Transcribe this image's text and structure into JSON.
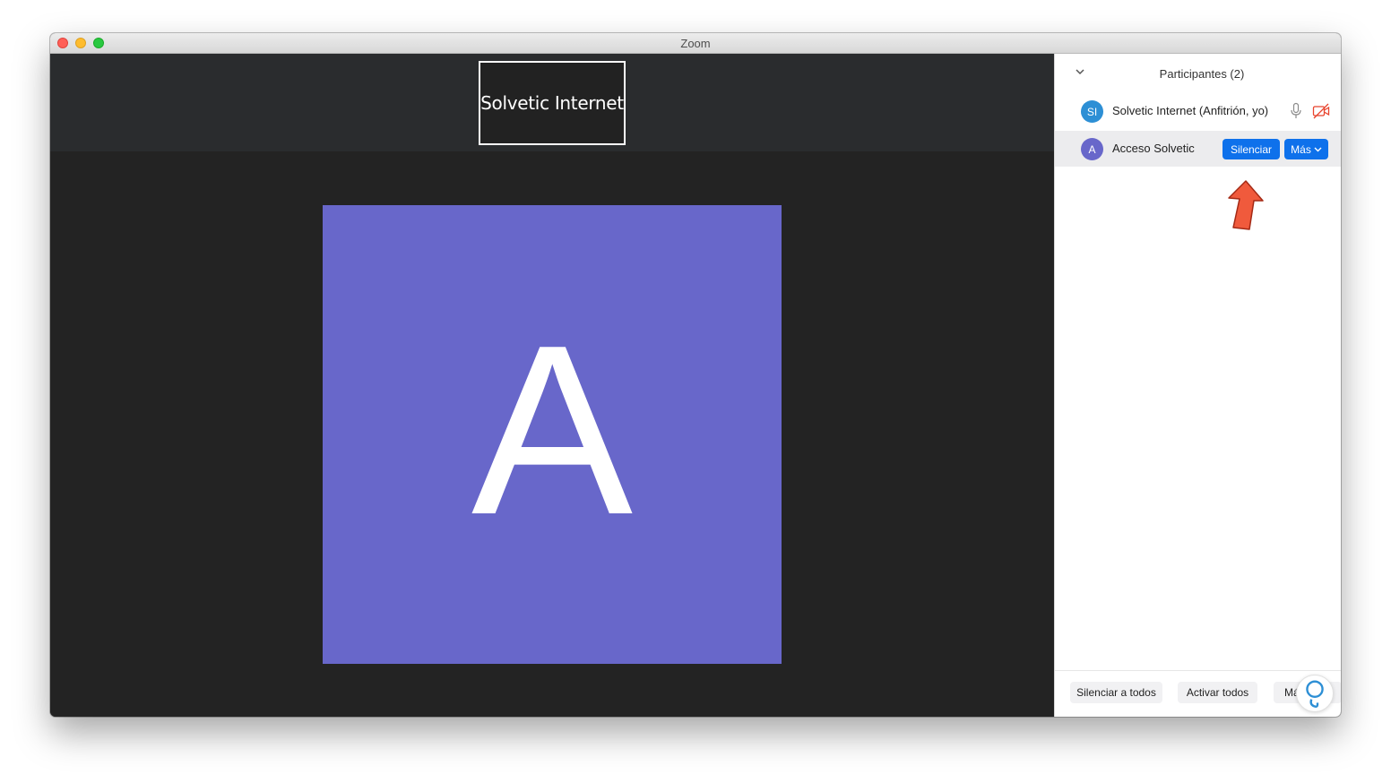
{
  "window": {
    "title": "Zoom"
  },
  "video": {
    "thumbnail_name": "Solvetic Internet",
    "main_initial": "A",
    "main_tile_color": "#6867ca"
  },
  "participants": {
    "title": "Participantes (2)",
    "collapse_icon": "chevron-down-icon",
    "list": [
      {
        "initials": "SI",
        "avatar_color": "#2d8fd5",
        "name": "Solvetic Internet (Anfitrión, yo)",
        "mic_icon": "microphone-icon",
        "video_icon": "video-off-icon"
      },
      {
        "initials": "A",
        "avatar_color": "#6867ca",
        "name": "Acceso Solvetic",
        "mute_label": "Silenciar",
        "more_label": "Más"
      }
    ],
    "footer": {
      "mute_all_label": "Silenciar a todos",
      "unmute_all_label": "Activar todos",
      "more_label": "Más"
    }
  },
  "annotation": {
    "arrow_icon": "red-arrow-icon",
    "arrow_color": "#f05a3c"
  },
  "colors": {
    "accent": "#0e71eb",
    "video_off": "#e8442e"
  }
}
